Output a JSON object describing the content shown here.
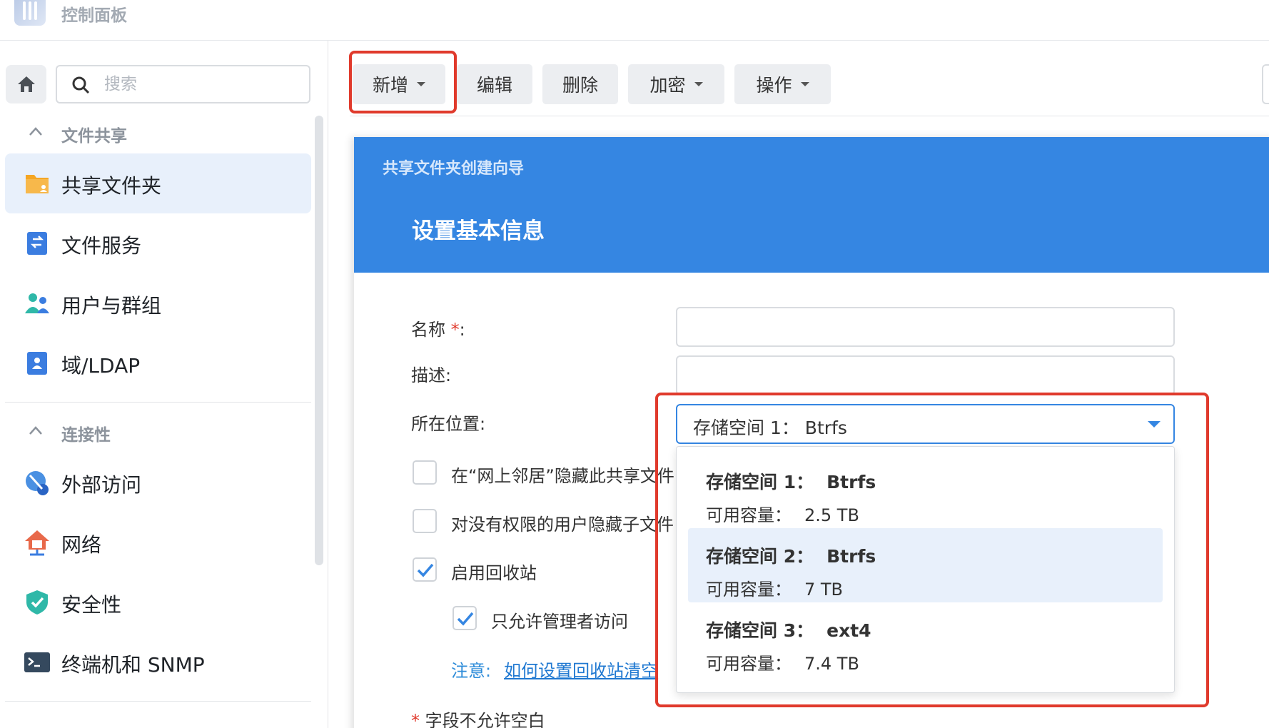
{
  "app": {
    "title": "控制面板"
  },
  "sidebar": {
    "search_placeholder": "搜索",
    "sections": [
      {
        "title": "文件共享",
        "items": [
          {
            "label": "共享文件夹",
            "icon": "shared-folder-icon",
            "active": true
          },
          {
            "label": "文件服务",
            "icon": "file-services-icon"
          },
          {
            "label": "用户与群组",
            "icon": "user-group-icon"
          },
          {
            "label": "域/LDAP",
            "icon": "domain-ldap-icon"
          }
        ]
      },
      {
        "title": "连接性",
        "items": [
          {
            "label": "外部访问",
            "icon": "external-access-icon"
          },
          {
            "label": "网络",
            "icon": "network-icon"
          },
          {
            "label": "安全性",
            "icon": "security-shield-icon"
          },
          {
            "label": "终端机和 SNMP",
            "icon": "terminal-icon"
          }
        ]
      }
    ]
  },
  "toolbar": {
    "create": "新增",
    "edit": "编辑",
    "delete": "删除",
    "encrypt": "加密",
    "action": "操作"
  },
  "wizard": {
    "subtitle": "共享文件夹创建向导",
    "title": "设置基本信息",
    "name_label": "名称",
    "name_value": "",
    "desc_label": "描述:",
    "desc_value": "",
    "location_label": "所在位置:",
    "location_value": "存储空间 1： Btrfs",
    "hide_network": "在“网上邻居”隐藏此共享文件",
    "hide_subfolders": "对没有权限的用户隐藏子文件",
    "enable_recycle": "启用回收站",
    "admin_only": "只允许管理者访问",
    "note_label": "注意:",
    "note_link": "如何设置回收站清空",
    "required_note": "字段不允许空白",
    "checkbox_states": {
      "hide_network": false,
      "hide_subfolders": false,
      "enable_recycle": true,
      "admin_only": true
    }
  },
  "dropdown": {
    "options": [
      {
        "name": "存储空间 1：",
        "fs": "Btrfs",
        "cap_label": "可用容量：",
        "cap": "2.5 TB",
        "selected": false
      },
      {
        "name": "存储空间 2：",
        "fs": "Btrfs",
        "cap_label": "可用容量：",
        "cap": "7 TB",
        "selected": true
      },
      {
        "name": "存储空间 3：",
        "fs": "ext4",
        "cap_label": "可用容量：",
        "cap": "7.4 TB",
        "selected": false
      }
    ]
  },
  "colors": {
    "accent": "#3586e2",
    "highlight": "#e03a2c",
    "selected_bg": "#e8f0fb"
  }
}
